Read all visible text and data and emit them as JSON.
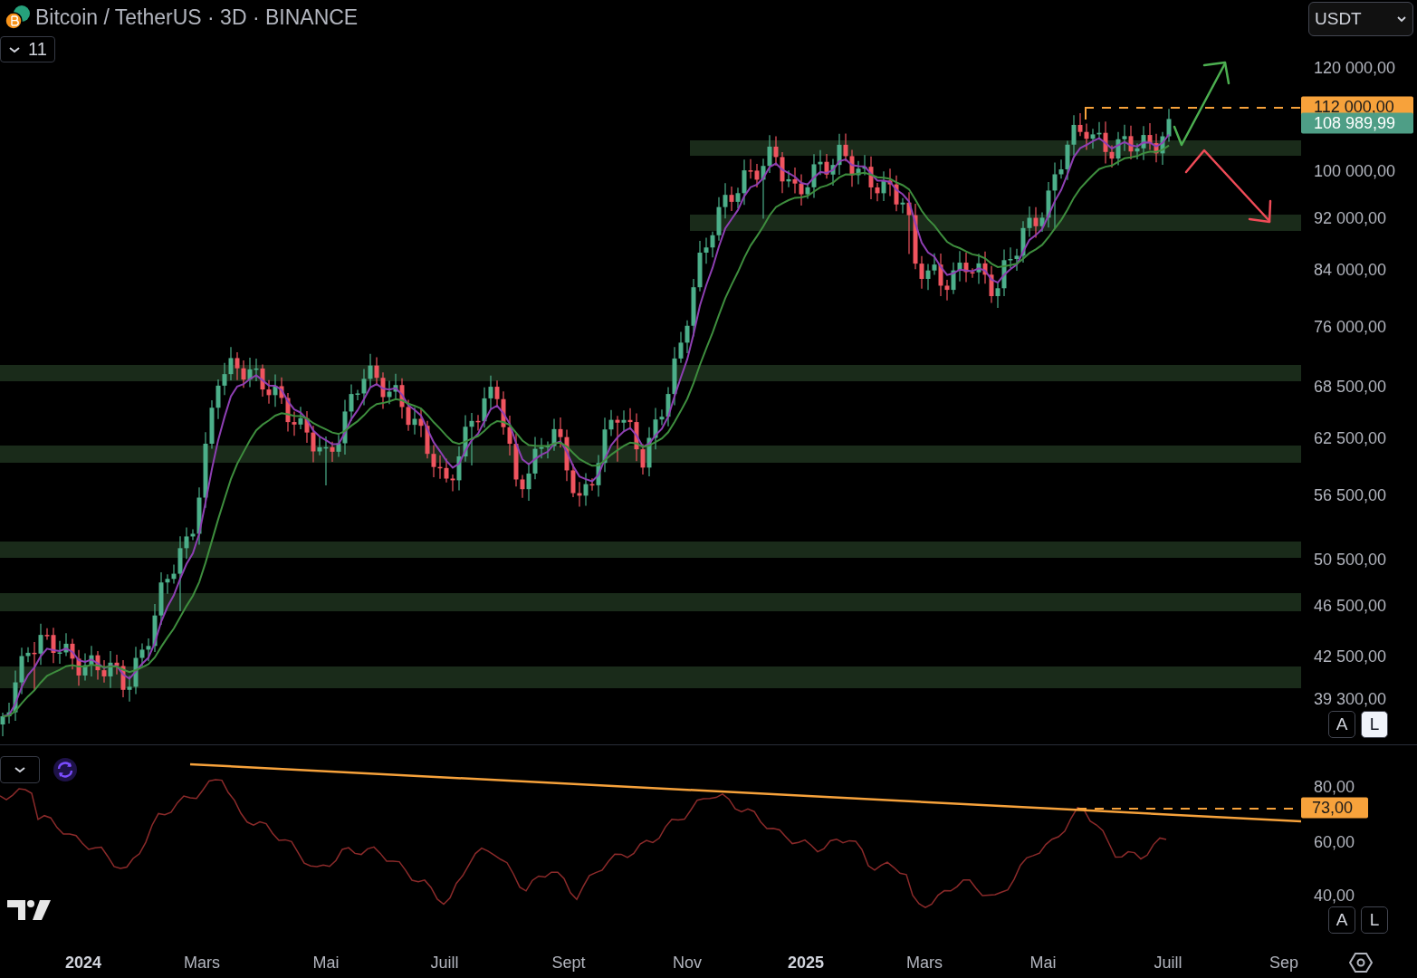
{
  "header": {
    "symbol_title": "Bitcoin / TetherUS · 3D · BINANCE",
    "indicator_toggle": {
      "expanded": false,
      "count": "11"
    }
  },
  "currency_selector": {
    "value": "USDT"
  },
  "price_axis": {
    "ticks": [
      "120 000,00",
      "100 000,00",
      "92 000,00",
      "84 000,00",
      "76 000,00",
      "68 500,00",
      "62 500,00",
      "56 500,00",
      "50 500,00",
      "46 500,00",
      "42 500,00",
      "39 300,00"
    ],
    "price_labels": [
      {
        "kind": "alert",
        "text": "112 000,00"
      },
      {
        "kind": "last",
        "text": "108 989,99"
      }
    ],
    "scale_buttons": [
      {
        "label": "A",
        "selected": false
      },
      {
        "label": "L",
        "selected": true
      }
    ]
  },
  "rsi_pane": {
    "expanded": false,
    "ticks": [
      "80,00",
      "60,00",
      "40,00"
    ],
    "level_label": "73,00",
    "scale_buttons": [
      {
        "label": "A",
        "selected": false
      },
      {
        "label": "L",
        "selected": false
      }
    ]
  },
  "time_axis": [
    {
      "label": "2024",
      "kind": "year"
    },
    {
      "label": "Mars",
      "kind": "month"
    },
    {
      "label": "Mai",
      "kind": "month"
    },
    {
      "label": "Juill",
      "kind": "month"
    },
    {
      "label": "Sept",
      "kind": "month"
    },
    {
      "label": "Nov",
      "kind": "month"
    },
    {
      "label": "2025",
      "kind": "year"
    },
    {
      "label": "Mars",
      "kind": "month"
    },
    {
      "label": "Mai",
      "kind": "month"
    },
    {
      "label": "Juill",
      "kind": "month"
    },
    {
      "label": "Sep",
      "kind": "month"
    }
  ]
}
